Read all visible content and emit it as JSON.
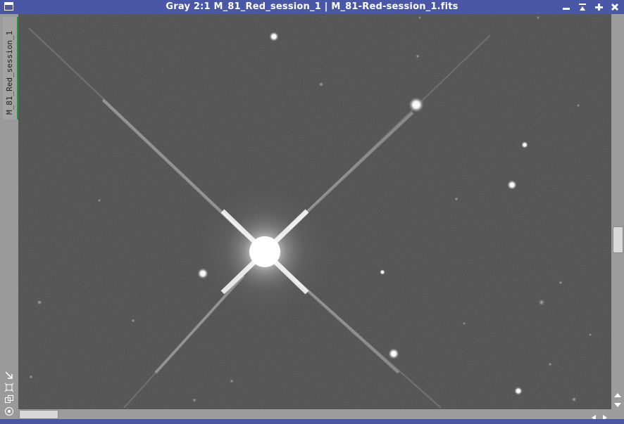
{
  "window": {
    "title": "Gray 2:1 M_81_Red_session_1 | M_81-Red-session_1.fits",
    "controls": [
      "minimize-icon",
      "shade-icon",
      "maximize-icon",
      "close-icon"
    ]
  },
  "side_tab": {
    "label": "M_81_Red_session_1",
    "accent": "#1a9a3a"
  },
  "side_tools": [
    "fit-view-icon",
    "zoom-to-fit-icon",
    "clone-icon",
    "target-icon"
  ],
  "colors": {
    "frame": "#4a56a6",
    "background_sky": "#454545",
    "scrollbar": "#9c9c9c"
  }
}
